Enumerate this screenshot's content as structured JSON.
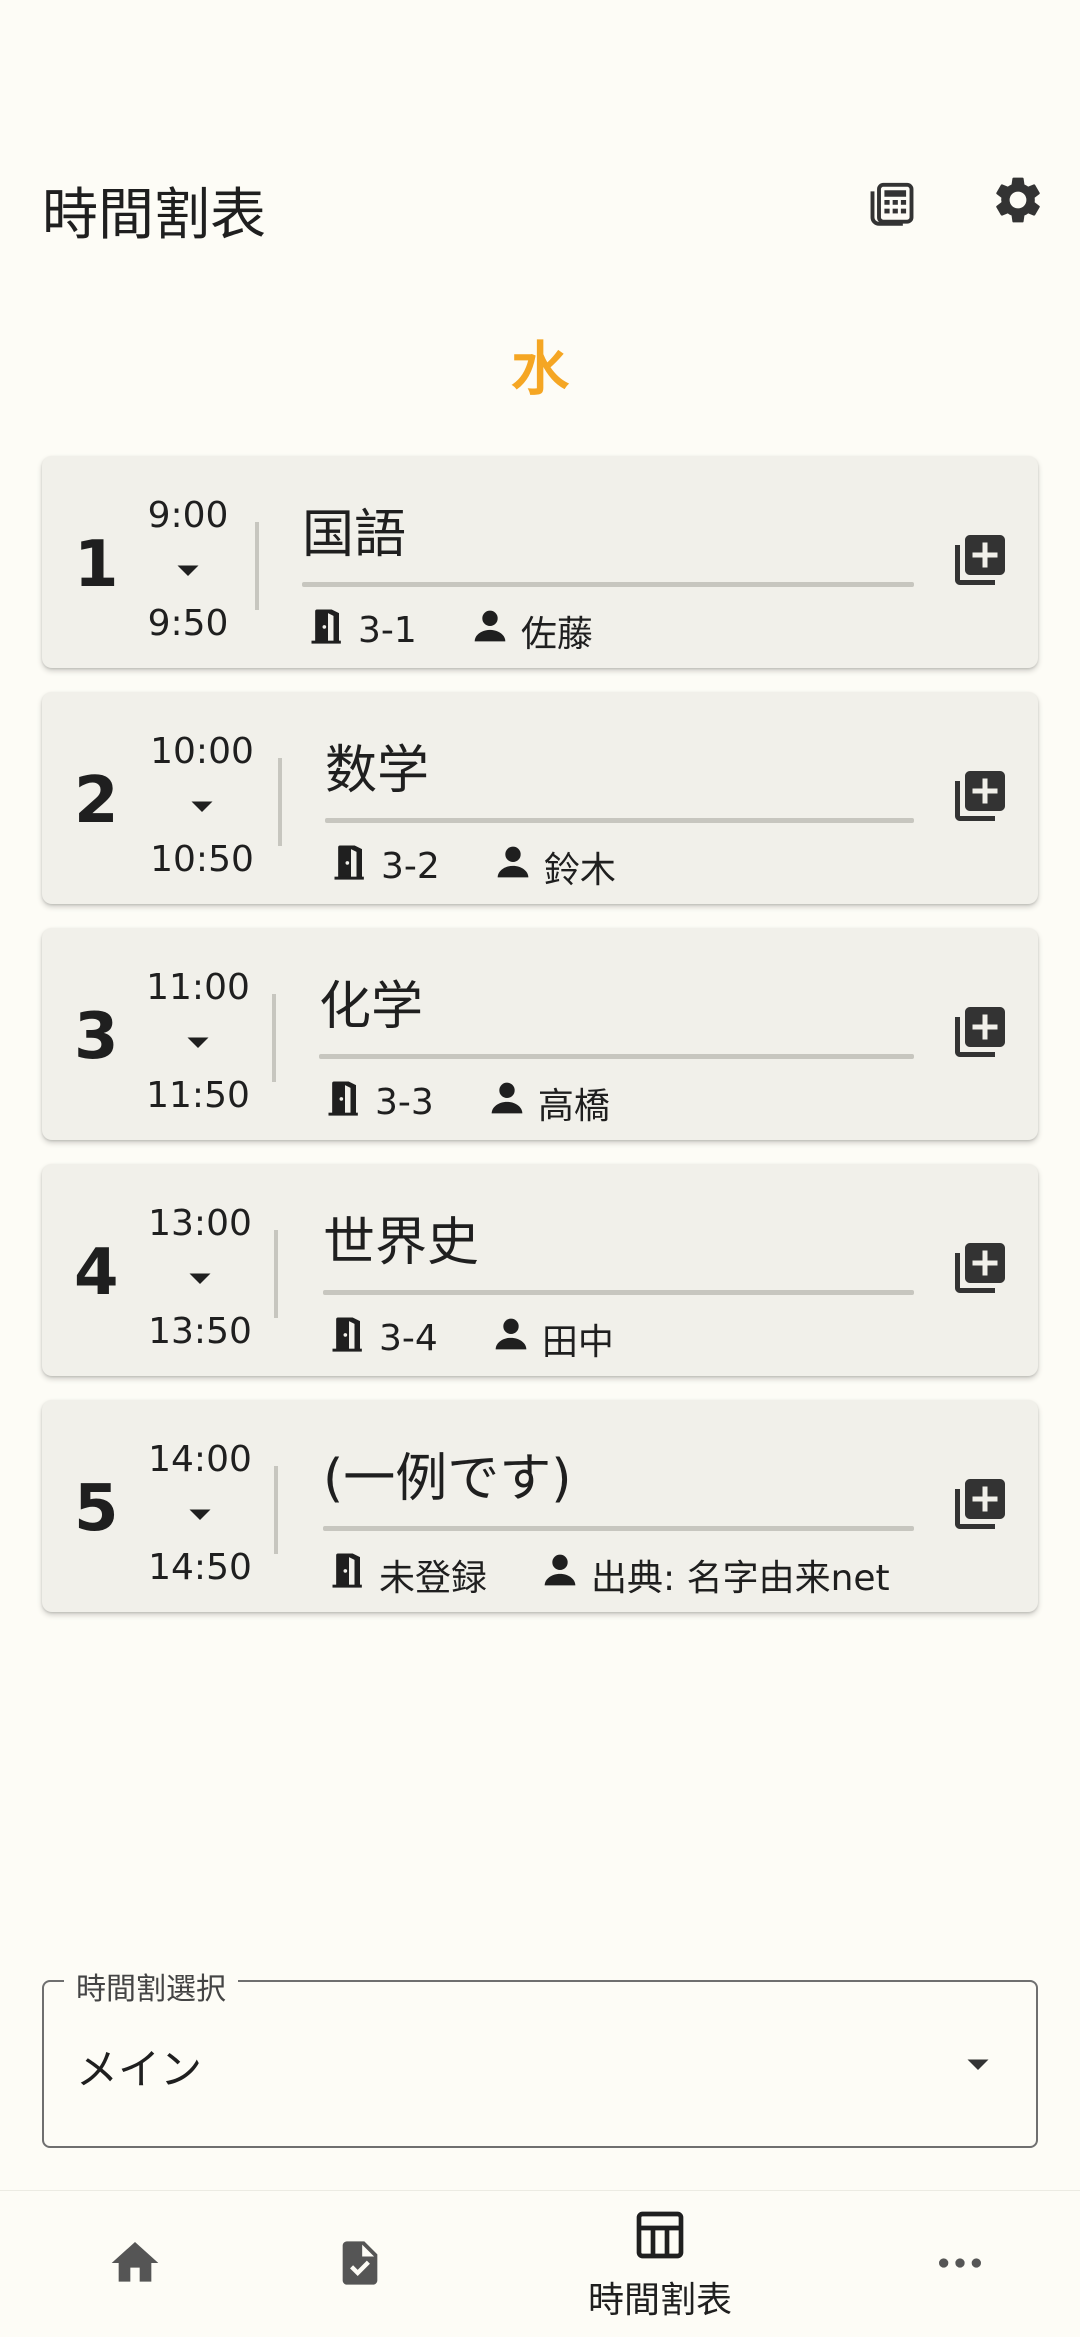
{
  "app_bar": {
    "title": "時間割表",
    "calculator_icon": "calculator-icon",
    "settings_icon": "gear-icon"
  },
  "day": "水",
  "colors": {
    "accent": "#f5a623",
    "card": "#f1f0ea",
    "divider": "#c7c6bf"
  },
  "periods": [
    {
      "num": "1",
      "start": "9:00",
      "end": "9:50",
      "subject": "国語",
      "room": "3-1",
      "teacher": "佐藤"
    },
    {
      "num": "2",
      "start": "10:00",
      "end": "10:50",
      "subject": "数学",
      "room": "3-2",
      "teacher": "鈴木"
    },
    {
      "num": "3",
      "start": "11:00",
      "end": "11:50",
      "subject": "化学",
      "room": "3-3",
      "teacher": "高橋"
    },
    {
      "num": "4",
      "start": "13:00",
      "end": "13:50",
      "subject": "世界史",
      "room": "3-4",
      "teacher": "田中"
    },
    {
      "num": "5",
      "start": "14:00",
      "end": "14:50",
      "subject": "(一例です)",
      "room": "未登録",
      "teacher": "出典: 名字由来net"
    }
  ],
  "timetable_select": {
    "label": "時間割選択",
    "value": "メイン"
  },
  "bottom_nav": {
    "items": [
      {
        "icon": "home-icon",
        "label": ""
      },
      {
        "icon": "task-document-icon",
        "label": ""
      },
      {
        "icon": "timetable-icon",
        "label": "時間割表"
      },
      {
        "icon": "more-icon",
        "label": ""
      }
    ]
  }
}
